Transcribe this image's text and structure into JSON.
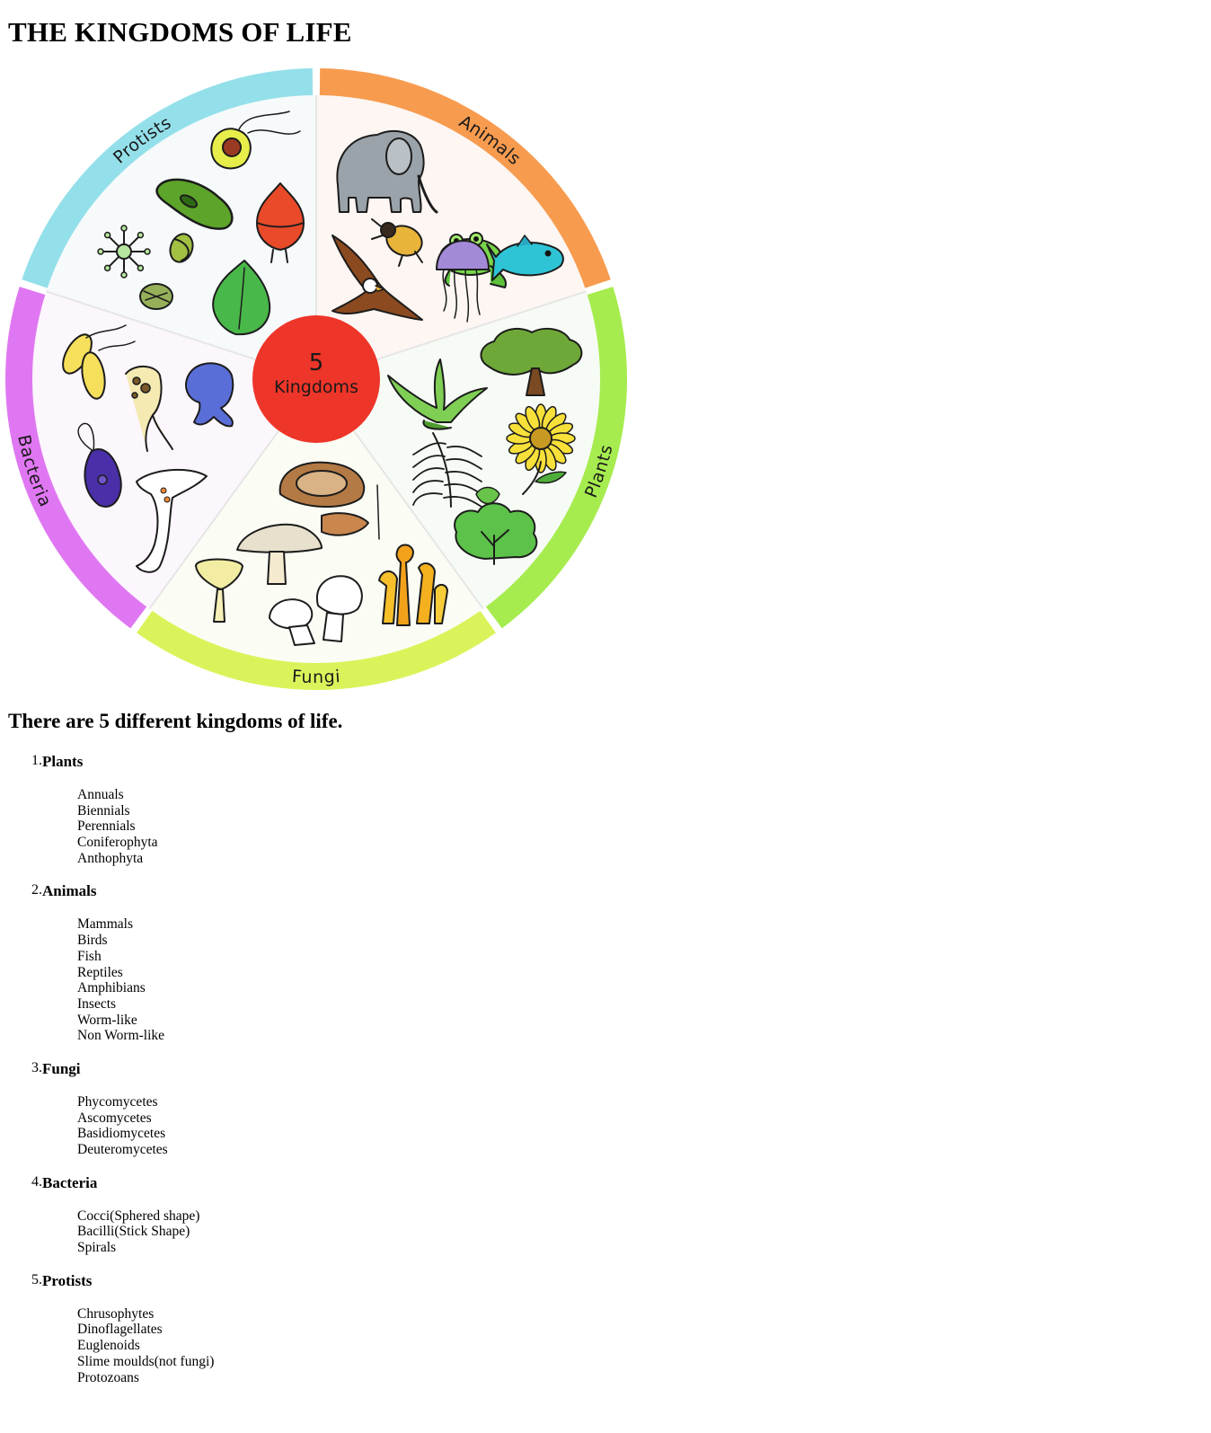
{
  "page": {
    "title": "THE KINGDOMS OF LIFE",
    "intro": "There are 5 different kingdoms of life."
  },
  "wheel": {
    "center_number": "5",
    "center_label": "Kingdoms",
    "center_color": "#ee3529",
    "segments": [
      {
        "label": "Animals",
        "ring_color": "#f79b4f",
        "bg_color": "#fdf6f2",
        "icons": [
          "elephant-icon",
          "frog-icon",
          "beetle-icon",
          "eagle-icon",
          "jellyfish-icon",
          "fish-icon"
        ]
      },
      {
        "label": "Plants",
        "ring_color": "#a6ec4f",
        "bg_color": "#f7fbf5",
        "icons": [
          "aloe-plant-icon",
          "tree-icon",
          "sunflower-icon",
          "fern-icon",
          "shrub-icon"
        ]
      },
      {
        "label": "Fungi",
        "ring_color": "#dbf35a",
        "bg_color": "#fbfcf4",
        "icons": [
          "shelf-fungus-icon",
          "mushroom-icon",
          "white-mushrooms-icon",
          "orange-mushrooms-icon",
          "funnel-mushroom-icon"
        ]
      },
      {
        "label": "Bacteria",
        "ring_color": "#e077f2",
        "bg_color": "#fcf6fd",
        "icons": [
          "bacillus-icon",
          "amoeba-icon",
          "flagellate-icon",
          "vorticella-icon",
          "spore-cell-icon"
        ]
      },
      {
        "label": "Protists",
        "ring_color": "#94e0ea",
        "bg_color": "#f6fafb",
        "icons": [
          "euglena-icon",
          "paramecium-icon",
          "dinoflagellate-icon",
          "radiolarian-icon",
          "diatom-icon",
          "seaweed-icon"
        ]
      }
    ]
  },
  "kingdoms": [
    {
      "number": "1.",
      "name": "Plants",
      "items": [
        "Annuals",
        "Biennials",
        "Perennials",
        "Coniferophyta",
        "Anthophyta"
      ]
    },
    {
      "number": "2.",
      "name": "Animals",
      "items": [
        "Mammals",
        "Birds",
        "Fish",
        "Reptiles",
        "Amphibians",
        "Insects",
        "Worm-like",
        "Non Worm-like"
      ]
    },
    {
      "number": "3.",
      "name": "Fungi",
      "items": [
        "Phycomycetes",
        "Ascomycetes",
        "Basidiomycetes",
        "Deuteromycetes"
      ]
    },
    {
      "number": "4.",
      "name": "Bacteria",
      "items": [
        "Cocci(Sphered shape)",
        "Bacilli(Stick Shape)",
        "Spirals"
      ]
    },
    {
      "number": "5.",
      "name": "Protists",
      "items": [
        "Chrusophytes",
        "Dinoflagellates",
        "Euglenoids",
        "Slime moulds(not fungi)",
        "Protozoans"
      ]
    }
  ]
}
